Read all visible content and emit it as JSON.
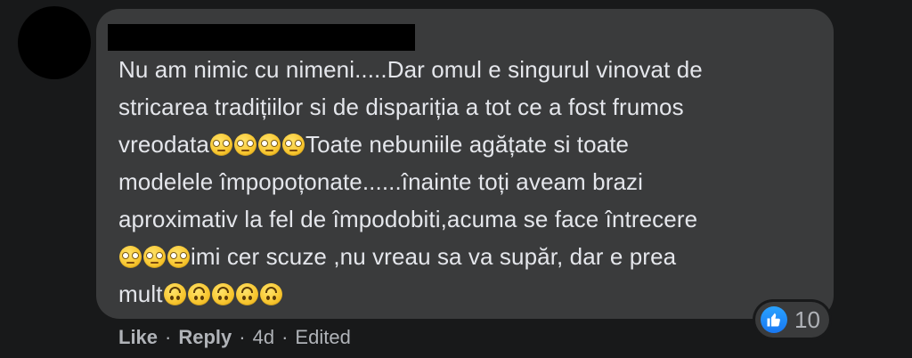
{
  "comment": {
    "author_redacted": true,
    "lines": [
      [
        {
          "t": "text",
          "v": "Nu am nimic cu nimeni.....Dar omul e singurul vinovat de"
        }
      ],
      [
        {
          "t": "text",
          "v": "stricarea tradițiilor si de dispariția a tot ce a fost frumos"
        }
      ],
      [
        {
          "t": "text",
          "v": "vreodata"
        },
        {
          "t": "emoji",
          "v": "flushed-face-icon"
        },
        {
          "t": "emoji",
          "v": "flushed-face-icon"
        },
        {
          "t": "emoji",
          "v": "flushed-face-icon"
        },
        {
          "t": "emoji",
          "v": "flushed-face-icon"
        },
        {
          "t": "text",
          "v": "Toate nebuniile agățate si toate"
        }
      ],
      [
        {
          "t": "text",
          "v": "modelele împopoțonate......înainte toți aveam brazi"
        }
      ],
      [
        {
          "t": "text",
          "v": "aproximativ la fel de împodobiti,acuma se face întrecere"
        }
      ],
      [
        {
          "t": "emoji",
          "v": "flushed-face-icon"
        },
        {
          "t": "emoji",
          "v": "flushed-face-icon"
        },
        {
          "t": "emoji",
          "v": "flushed-face-icon"
        },
        {
          "t": "text",
          "v": "imi cer scuze ,nu vreau sa va supăr, dar e prea"
        }
      ],
      [
        {
          "t": "text",
          "v": "mult"
        },
        {
          "t": "emoji",
          "v": "upside-down-face-icon"
        },
        {
          "t": "emoji",
          "v": "upside-down-face-icon"
        },
        {
          "t": "emoji",
          "v": "upside-down-face-icon"
        },
        {
          "t": "emoji",
          "v": "upside-down-face-icon"
        },
        {
          "t": "emoji",
          "v": "upside-down-face-icon"
        }
      ]
    ]
  },
  "reactions": {
    "icon": "thumbs-up-icon",
    "count": "10",
    "color": "#1877f2"
  },
  "actions": {
    "like_label": "Like",
    "reply_label": "Reply",
    "separator": "·",
    "time": "4d",
    "edited_label": "Edited"
  },
  "colors": {
    "background": "#18191a",
    "bubble": "#3a3b3c",
    "text": "#e4e6eb",
    "secondary_text": "#b0b3b8"
  }
}
